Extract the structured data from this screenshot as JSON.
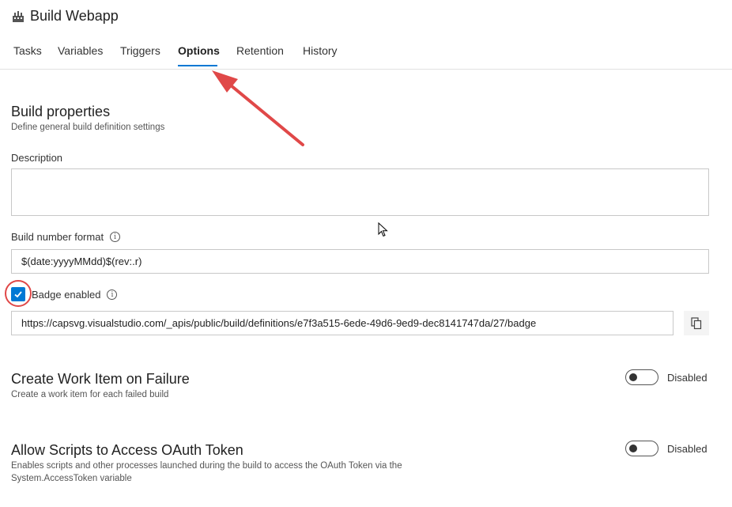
{
  "header": {
    "title": "Build Webapp",
    "icon": "build-pipeline-icon"
  },
  "tabs": [
    {
      "label": "Tasks"
    },
    {
      "label": "Variables"
    },
    {
      "label": "Triggers"
    },
    {
      "label": "Options",
      "active": true
    },
    {
      "label": "Retention"
    },
    {
      "label": "History"
    }
  ],
  "build_properties": {
    "heading": "Build properties",
    "subtitle": "Define general build definition settings",
    "description_label": "Description",
    "description_value": "",
    "build_number_label": "Build number format",
    "build_number_value": "$(date:yyyyMMdd)$(rev:.r)",
    "badge_label": "Badge enabled",
    "badge_checked": true,
    "badge_url": "https://capsvg.visualstudio.com/_apis/public/build/definitions/e7f3a515-6ede-49d6-9ed9-dec8141747da/27/badge"
  },
  "work_item": {
    "heading": "Create Work Item on Failure",
    "subtitle": "Create a work item for each failed build",
    "toggle_state": "Disabled"
  },
  "oauth": {
    "heading": "Allow Scripts to Access OAuth Token",
    "subtitle_line1": "Enables scripts and other processes launched during the build to access the OAuth Token via the",
    "subtitle_line2": "System.AccessToken variable",
    "toggle_state": "Disabled"
  },
  "colors": {
    "accent": "#0078d4",
    "annotation": "#e04848"
  }
}
